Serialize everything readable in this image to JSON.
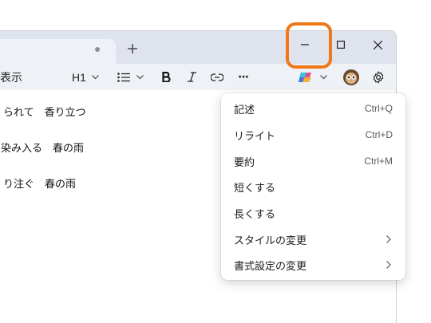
{
  "toolbar": {
    "view_label": "表示",
    "heading_label": "H1",
    "more_label": "···"
  },
  "editor": {
    "lines": [
      "られて　香り立つ",
      "染み入る　春の雨",
      "り注ぐ　春の雨"
    ]
  },
  "menu": {
    "items": [
      {
        "label": "記述",
        "shortcut": "Ctrl+Q"
      },
      {
        "label": "リライト",
        "shortcut": "Ctrl+D"
      },
      {
        "label": "要約",
        "shortcut": "Ctrl+M"
      },
      {
        "label": "短くする",
        "shortcut": ""
      },
      {
        "label": "長くする",
        "shortcut": ""
      },
      {
        "label": "スタイルの変更",
        "shortcut": ""
      },
      {
        "label": "書式設定の変更",
        "shortcut": ""
      }
    ]
  },
  "colors": {
    "highlight": "#f07816",
    "titlebar": "#dfe3ee",
    "toolbar": "#eef1f6"
  },
  "icons": [
    "close-icon",
    "maximize-icon",
    "minimize-icon",
    "plus-icon",
    "chevron-down-icon",
    "list-icon",
    "bold-icon",
    "italic-icon",
    "link-icon",
    "copilot-icon",
    "avatar",
    "gear-icon",
    "chevron-right-icon"
  ]
}
